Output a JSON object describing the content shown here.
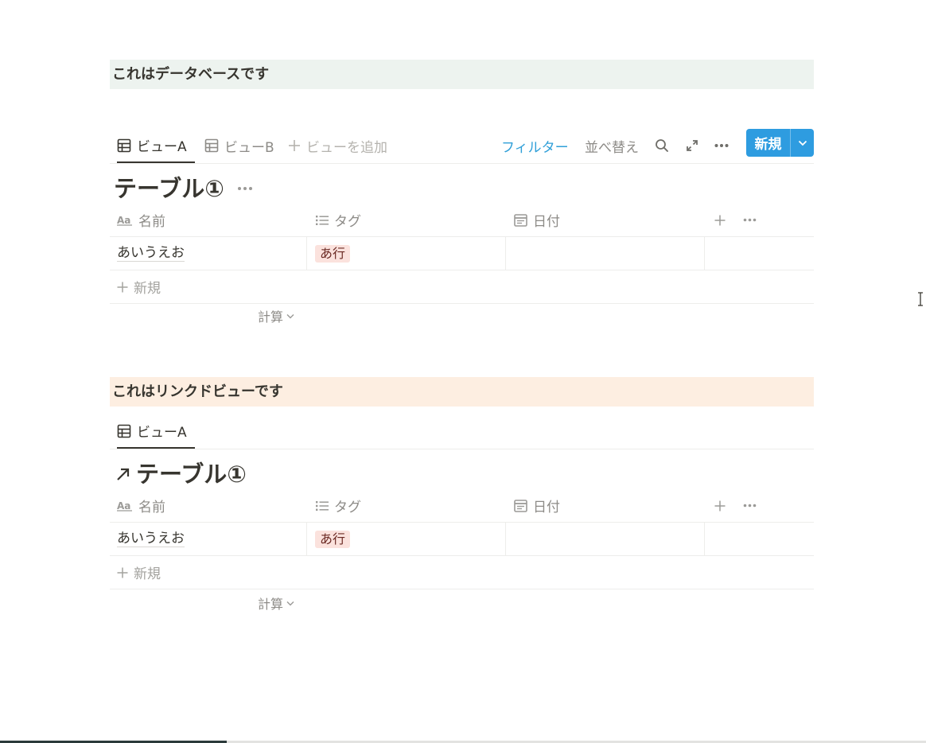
{
  "colors": {
    "database_callout_bg": "#edf3ef",
    "linked_callout_bg": "#fdeee1",
    "accent": "#2e9ce0",
    "tag_bg": "#fbe2dd"
  },
  "database_block": {
    "callout_text": "これはデータベースです",
    "tabs": [
      {
        "label": "ビューA",
        "icon": "table-icon",
        "active": true
      },
      {
        "label": "ビューB",
        "icon": "table-icon",
        "active": false
      },
      {
        "label": "ビューを追加",
        "icon": "plus-icon",
        "active": false
      }
    ],
    "toolbar": {
      "filter_label": "フィルター",
      "sort_label": "並べ替え",
      "search_icon": "search-icon",
      "expand_icon": "expand-icon",
      "more_icon": "more-icon",
      "new_label": "新規",
      "new_caret_icon": "chevron-down-icon"
    },
    "title": "テーブル①",
    "columns": [
      {
        "label": "名前",
        "icon": "text-property-icon"
      },
      {
        "label": "タグ",
        "icon": "list-property-icon"
      },
      {
        "label": "日付",
        "icon": "calendar-icon"
      }
    ],
    "rows": [
      {
        "name": "あいうえお",
        "tag": "あ行",
        "date": ""
      }
    ],
    "add_row_label": "新規",
    "calc_label": "計算"
  },
  "linked_block": {
    "callout_text": "これはリンクドビューです",
    "tabs": [
      {
        "label": "ビューA",
        "icon": "table-icon",
        "active": true
      }
    ],
    "title": "テーブル①",
    "title_icon": "arrow-up-right-icon",
    "columns": [
      {
        "label": "名前",
        "icon": "text-property-icon"
      },
      {
        "label": "タグ",
        "icon": "list-property-icon"
      },
      {
        "label": "日付",
        "icon": "calendar-icon"
      }
    ],
    "rows": [
      {
        "name": "あいうえお",
        "tag": "あ行",
        "date": ""
      }
    ],
    "add_row_label": "新規",
    "calc_label": "計算"
  },
  "page_load_progress": 0.245
}
